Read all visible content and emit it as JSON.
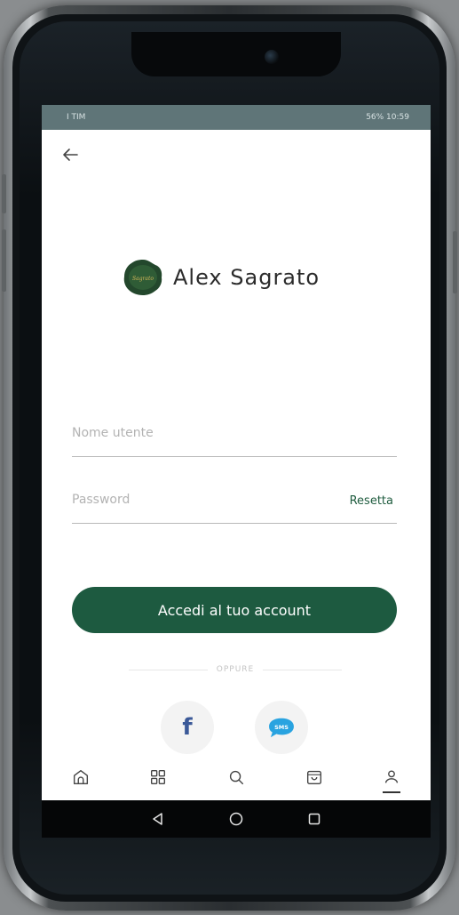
{
  "status_bar": {
    "left": "I TIM",
    "right": "56% 10:59"
  },
  "brand": {
    "name": "Alex Sagrato",
    "logo_text": "Sagrato"
  },
  "form": {
    "username_placeholder": "Nome utente",
    "password_placeholder": "Password",
    "reset_label": "Resetta",
    "submit_label": "Accedi al tuo account"
  },
  "divider_text": "OPPURE",
  "social": {
    "facebook_label": "f",
    "sms_label": "SMS"
  },
  "bottom_nav": [
    {
      "icon": "home-icon"
    },
    {
      "icon": "grid-icon"
    },
    {
      "icon": "search-icon"
    },
    {
      "icon": "bag-icon"
    },
    {
      "icon": "user-icon",
      "active": true
    }
  ],
  "colors": {
    "primary": "#1d5a40",
    "status_bar": "#5f7578",
    "facebook": "#3b5998",
    "sms": "#29a3e0"
  }
}
